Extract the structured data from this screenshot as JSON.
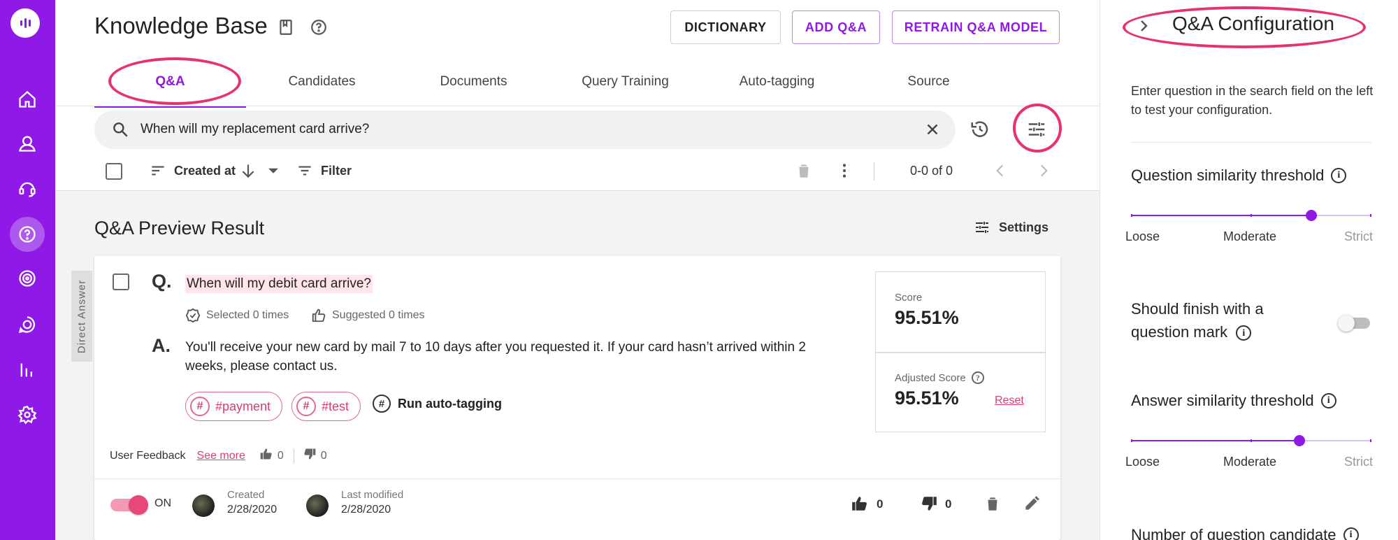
{
  "nav": {
    "accent": "#8f19e6",
    "items": [
      "home-icon",
      "user-icon",
      "chat-agent-icon",
      "help-icon",
      "target-icon",
      "conversation-icon",
      "analytics-icon",
      "settings-icon"
    ],
    "active_item": "help-icon"
  },
  "header": {
    "title": "Knowledge Base",
    "dictionary_label": "DICTIONARY",
    "add_qa_label": "ADD Q&A",
    "retrain_label": "RETRAIN Q&A MODEL"
  },
  "tabs": [
    {
      "label": "Q&A",
      "active": true
    },
    {
      "label": "Candidates",
      "active": false
    },
    {
      "label": "Documents",
      "active": false
    },
    {
      "label": "Query Training",
      "active": false
    },
    {
      "label": "Auto-tagging",
      "active": false
    },
    {
      "label": "Source",
      "active": false
    }
  ],
  "search": {
    "value": "When will my replacement card arrive?"
  },
  "toolbar": {
    "sort_label": "Created at",
    "filter_label": "Filter",
    "pagination": "0-0 of 0"
  },
  "preview": {
    "title": "Q&A Preview Result",
    "settings_label": "Settings",
    "direct_answer_tag": "Direct Answer",
    "card": {
      "q_letter": "Q.",
      "question": "When will my debit card arrive?",
      "selected": "Selected 0 times",
      "suggested": "Suggested 0 times",
      "a_letter": "A.",
      "answer": "You'll receive your new card by mail 7 to 10 days after you requested it. If your card hasn’t arrived within 2 weeks, please contact us.",
      "tags": [
        "#payment",
        "#test"
      ],
      "run_autotag_label": "Run auto-tagging",
      "score_label": "Score",
      "score_value": "95.51%",
      "adjusted_label": "Adjusted Score",
      "adjusted_value": "95.51%",
      "reset_label": "Reset",
      "feedback_label": "User Feedback",
      "see_more_label": "See more",
      "feedback_up": "0",
      "feedback_down": "0",
      "toggle_label": "ON",
      "toggle_on": true,
      "created_label": "Created",
      "created_date": "2/28/2020",
      "modified_label": "Last modified",
      "modified_date": "2/28/2020",
      "likes": "0",
      "dislikes": "0"
    }
  },
  "config": {
    "title": "Q&A Configuration",
    "description": "Enter question in the search field on the left to test your configuration.",
    "question_threshold_label": "Question similarity threshold",
    "question_threshold_level": 0.75,
    "should_finish_label": "Should finish with a question mark",
    "should_finish_on": false,
    "answer_threshold_label": "Answer similarity threshold",
    "answer_threshold_level": 0.7,
    "scale": {
      "loose": "Loose",
      "moderate": "Moderate",
      "strict": "Strict"
    },
    "candidate_label": "Number of question candidate"
  },
  "highlight_color": "#e6336d"
}
